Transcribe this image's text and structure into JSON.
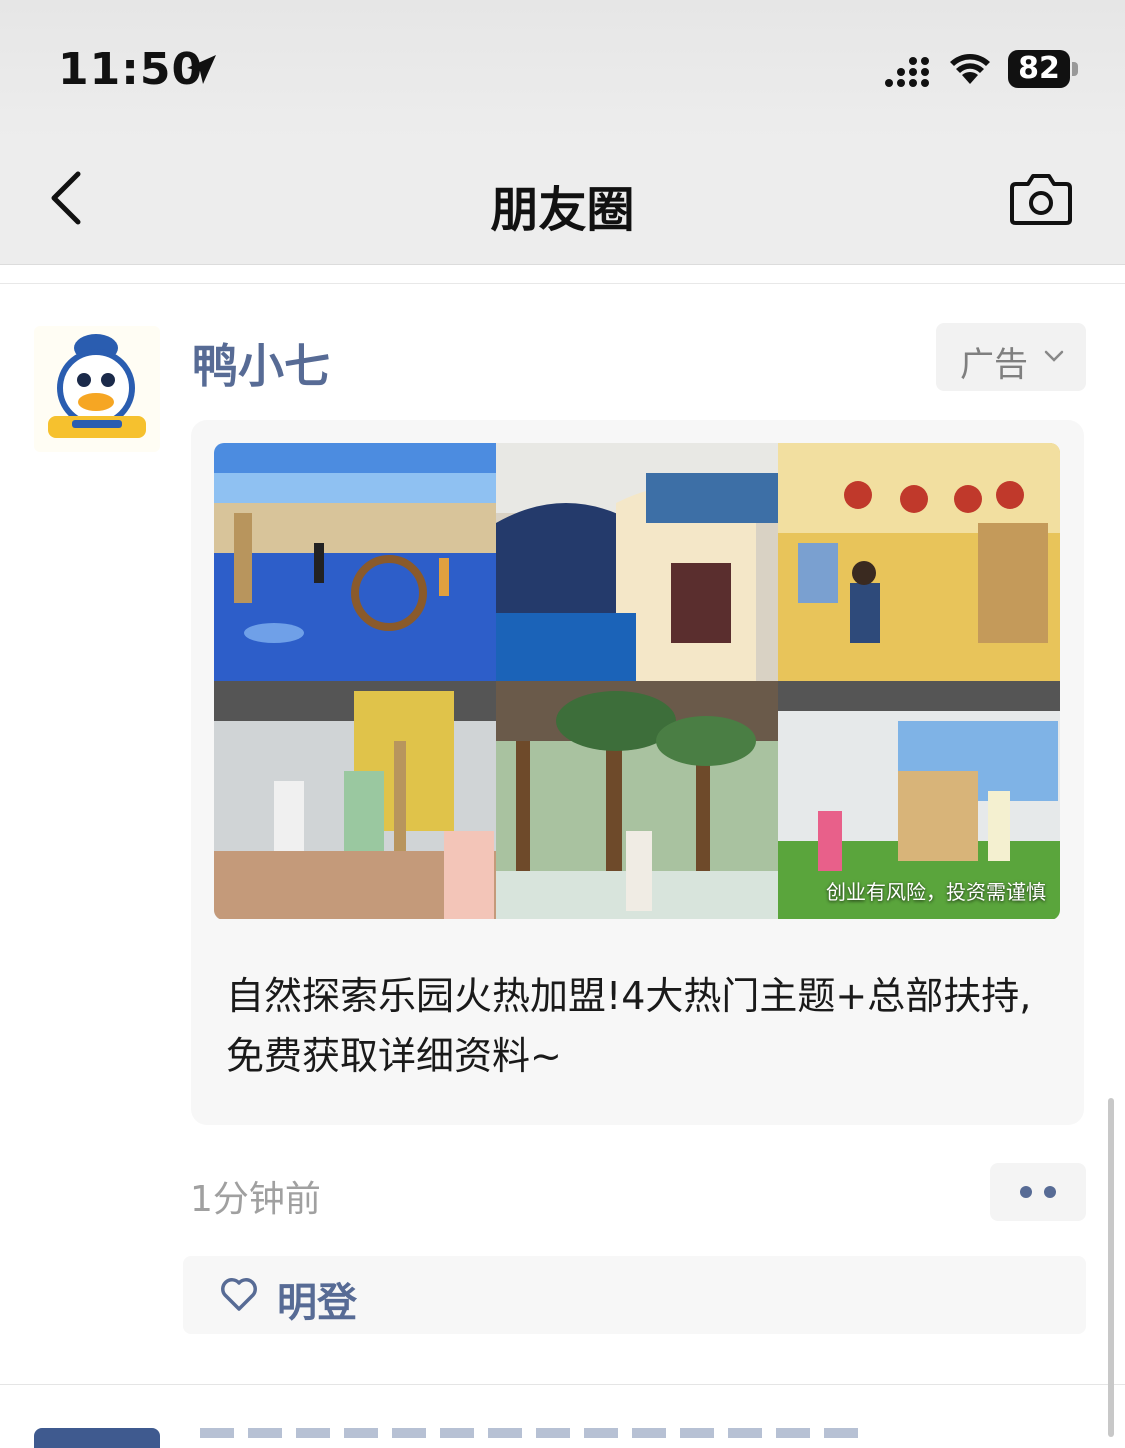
{
  "status_bar": {
    "time": "11:50",
    "battery": "82"
  },
  "nav": {
    "title": "朋友圈"
  },
  "post": {
    "author": "鸭小七",
    "ad_label": "广告",
    "image_caption": "创业有风险，投资需谨慎",
    "text": "自然探索乐园火热加盟!4大热门主题+总部扶持,免费获取详细资料~",
    "timestamp": "1分钟前",
    "liker": "明登"
  },
  "colors": {
    "link": "#576b95",
    "muted": "#a0a0a0",
    "nav_bg": "#ededed"
  },
  "icons": [
    "location-arrow-icon",
    "cellular-signal-icon",
    "wifi-icon",
    "battery-icon",
    "back-chevron-icon",
    "camera-icon",
    "chevron-down-icon",
    "heart-icon",
    "more-dots-icon"
  ]
}
